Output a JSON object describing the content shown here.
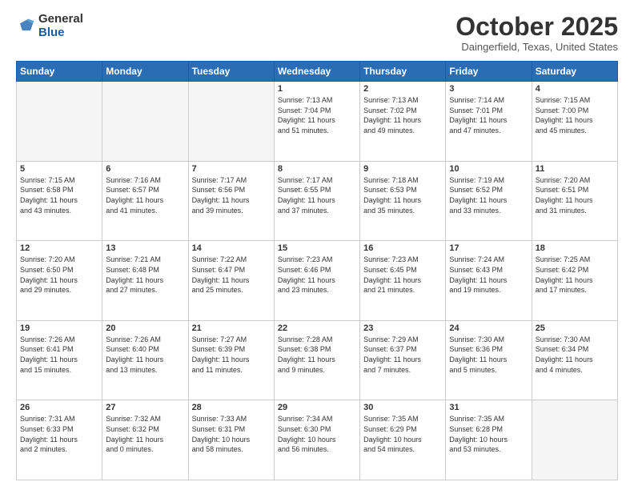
{
  "logo": {
    "general": "General",
    "blue": "Blue"
  },
  "header": {
    "month": "October 2025",
    "location": "Daingerfield, Texas, United States"
  },
  "weekdays": [
    "Sunday",
    "Monday",
    "Tuesday",
    "Wednesday",
    "Thursday",
    "Friday",
    "Saturday"
  ],
  "weeks": [
    [
      {
        "day": "",
        "info": ""
      },
      {
        "day": "",
        "info": ""
      },
      {
        "day": "",
        "info": ""
      },
      {
        "day": "1",
        "info": "Sunrise: 7:13 AM\nSunset: 7:04 PM\nDaylight: 11 hours\nand 51 minutes."
      },
      {
        "day": "2",
        "info": "Sunrise: 7:13 AM\nSunset: 7:02 PM\nDaylight: 11 hours\nand 49 minutes."
      },
      {
        "day": "3",
        "info": "Sunrise: 7:14 AM\nSunset: 7:01 PM\nDaylight: 11 hours\nand 47 minutes."
      },
      {
        "day": "4",
        "info": "Sunrise: 7:15 AM\nSunset: 7:00 PM\nDaylight: 11 hours\nand 45 minutes."
      }
    ],
    [
      {
        "day": "5",
        "info": "Sunrise: 7:15 AM\nSunset: 6:58 PM\nDaylight: 11 hours\nand 43 minutes."
      },
      {
        "day": "6",
        "info": "Sunrise: 7:16 AM\nSunset: 6:57 PM\nDaylight: 11 hours\nand 41 minutes."
      },
      {
        "day": "7",
        "info": "Sunrise: 7:17 AM\nSunset: 6:56 PM\nDaylight: 11 hours\nand 39 minutes."
      },
      {
        "day": "8",
        "info": "Sunrise: 7:17 AM\nSunset: 6:55 PM\nDaylight: 11 hours\nand 37 minutes."
      },
      {
        "day": "9",
        "info": "Sunrise: 7:18 AM\nSunset: 6:53 PM\nDaylight: 11 hours\nand 35 minutes."
      },
      {
        "day": "10",
        "info": "Sunrise: 7:19 AM\nSunset: 6:52 PM\nDaylight: 11 hours\nand 33 minutes."
      },
      {
        "day": "11",
        "info": "Sunrise: 7:20 AM\nSunset: 6:51 PM\nDaylight: 11 hours\nand 31 minutes."
      }
    ],
    [
      {
        "day": "12",
        "info": "Sunrise: 7:20 AM\nSunset: 6:50 PM\nDaylight: 11 hours\nand 29 minutes."
      },
      {
        "day": "13",
        "info": "Sunrise: 7:21 AM\nSunset: 6:48 PM\nDaylight: 11 hours\nand 27 minutes."
      },
      {
        "day": "14",
        "info": "Sunrise: 7:22 AM\nSunset: 6:47 PM\nDaylight: 11 hours\nand 25 minutes."
      },
      {
        "day": "15",
        "info": "Sunrise: 7:23 AM\nSunset: 6:46 PM\nDaylight: 11 hours\nand 23 minutes."
      },
      {
        "day": "16",
        "info": "Sunrise: 7:23 AM\nSunset: 6:45 PM\nDaylight: 11 hours\nand 21 minutes."
      },
      {
        "day": "17",
        "info": "Sunrise: 7:24 AM\nSunset: 6:43 PM\nDaylight: 11 hours\nand 19 minutes."
      },
      {
        "day": "18",
        "info": "Sunrise: 7:25 AM\nSunset: 6:42 PM\nDaylight: 11 hours\nand 17 minutes."
      }
    ],
    [
      {
        "day": "19",
        "info": "Sunrise: 7:26 AM\nSunset: 6:41 PM\nDaylight: 11 hours\nand 15 minutes."
      },
      {
        "day": "20",
        "info": "Sunrise: 7:26 AM\nSunset: 6:40 PM\nDaylight: 11 hours\nand 13 minutes."
      },
      {
        "day": "21",
        "info": "Sunrise: 7:27 AM\nSunset: 6:39 PM\nDaylight: 11 hours\nand 11 minutes."
      },
      {
        "day": "22",
        "info": "Sunrise: 7:28 AM\nSunset: 6:38 PM\nDaylight: 11 hours\nand 9 minutes."
      },
      {
        "day": "23",
        "info": "Sunrise: 7:29 AM\nSunset: 6:37 PM\nDaylight: 11 hours\nand 7 minutes."
      },
      {
        "day": "24",
        "info": "Sunrise: 7:30 AM\nSunset: 6:36 PM\nDaylight: 11 hours\nand 5 minutes."
      },
      {
        "day": "25",
        "info": "Sunrise: 7:30 AM\nSunset: 6:34 PM\nDaylight: 11 hours\nand 4 minutes."
      }
    ],
    [
      {
        "day": "26",
        "info": "Sunrise: 7:31 AM\nSunset: 6:33 PM\nDaylight: 11 hours\nand 2 minutes."
      },
      {
        "day": "27",
        "info": "Sunrise: 7:32 AM\nSunset: 6:32 PM\nDaylight: 11 hours\nand 0 minutes."
      },
      {
        "day": "28",
        "info": "Sunrise: 7:33 AM\nSunset: 6:31 PM\nDaylight: 10 hours\nand 58 minutes."
      },
      {
        "day": "29",
        "info": "Sunrise: 7:34 AM\nSunset: 6:30 PM\nDaylight: 10 hours\nand 56 minutes."
      },
      {
        "day": "30",
        "info": "Sunrise: 7:35 AM\nSunset: 6:29 PM\nDaylight: 10 hours\nand 54 minutes."
      },
      {
        "day": "31",
        "info": "Sunrise: 7:35 AM\nSunset: 6:28 PM\nDaylight: 10 hours\nand 53 minutes."
      },
      {
        "day": "",
        "info": ""
      }
    ]
  ]
}
